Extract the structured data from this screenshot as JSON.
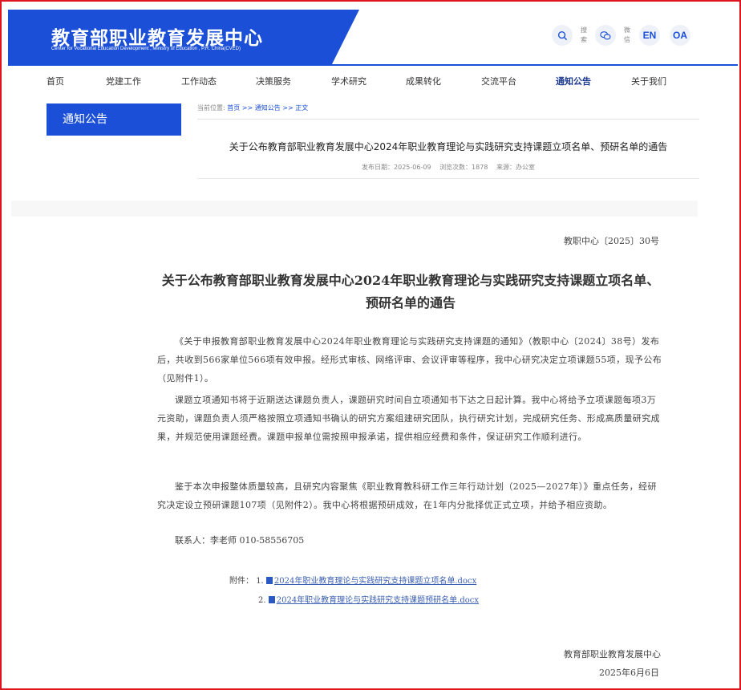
{
  "header": {
    "logo_cn": "教育部职业教育发展中心",
    "logo_en": "Center for Vocational Education Development , Ministry of Education , P.R. China(CVED)",
    "search_label": "搜索",
    "wechat_label": "微信",
    "en_label": "EN",
    "oa_label": "OA"
  },
  "nav": {
    "items": [
      "首页",
      "党建工作",
      "工作动态",
      "决策服务",
      "学术研究",
      "成果转化",
      "交流平台",
      "通知公告",
      "关于我们"
    ]
  },
  "sidebar": {
    "title": "通知公告"
  },
  "breadcrumb": {
    "label": "当前位置:",
    "home": "首页",
    "sep1": " >> ",
    "section": "通知公告",
    "sep2": " >> ",
    "current": "正文"
  },
  "article": {
    "title": "关于公布教育部职业教育发展中心2024年职业教育理论与实践研究支持课题立项名单、预研名单的通告",
    "date": "发布日期：2025-06-09",
    "views": "浏览次数：1878",
    "source": "来源：办公室"
  },
  "document": {
    "doc_no": "教职中心〔2025〕30号",
    "title": "关于公布教育部职业教育发展中心2024年职业教育理论与实践研究支持课题立项名单、预研名单的通告",
    "para1": "《关于申报教育部职业教育发展中心2024年职业教育理论与实践研究支持课题的通知》（教职中心〔2024〕38号）发布后，共收到566家单位566项有效申报。经形式审核、网络评审、会议评审等程序，我中心研究决定立项课题55项，现予公布（见附件1）。",
    "para2": "课题立项通知书将于近期送达课题负责人，课题研究时间自立项通知书下达之日起计算。我中心将给予立项课题每项3万元资助，课题负责人须严格按照立项通知书确认的研究方案组建研究团队，执行研究计划，完成研究任务、形成高质量研究成果，并规范使用课题经费。课题申报单位需按照申报承诺，提供相应经费和条件，保证研究工作顺利进行。",
    "para3": "鉴于本次申报整体质量较高，且研究内容聚焦《职业教育教科研工作三年行动计划（2025—2027年）》重点任务，经研究决定设立预研课题107项（见附件2）。我中心将根据预研成效，在1年内分批择优正式立项，并给予相应资助。",
    "contact": "联系人：李老师 010-58556705",
    "attach_label": "附件：",
    "attach1_no": "1.",
    "attach1": "2024年职业教育理论与实践研究支持课题立项名单.docx",
    "attach2_no": "2.",
    "attach2": "2024年职业教育理论与实践研究支持课题预研名单.docx",
    "sign_org": "教育部职业教育发展中心",
    "sign_date": "2025年6月6日"
  }
}
